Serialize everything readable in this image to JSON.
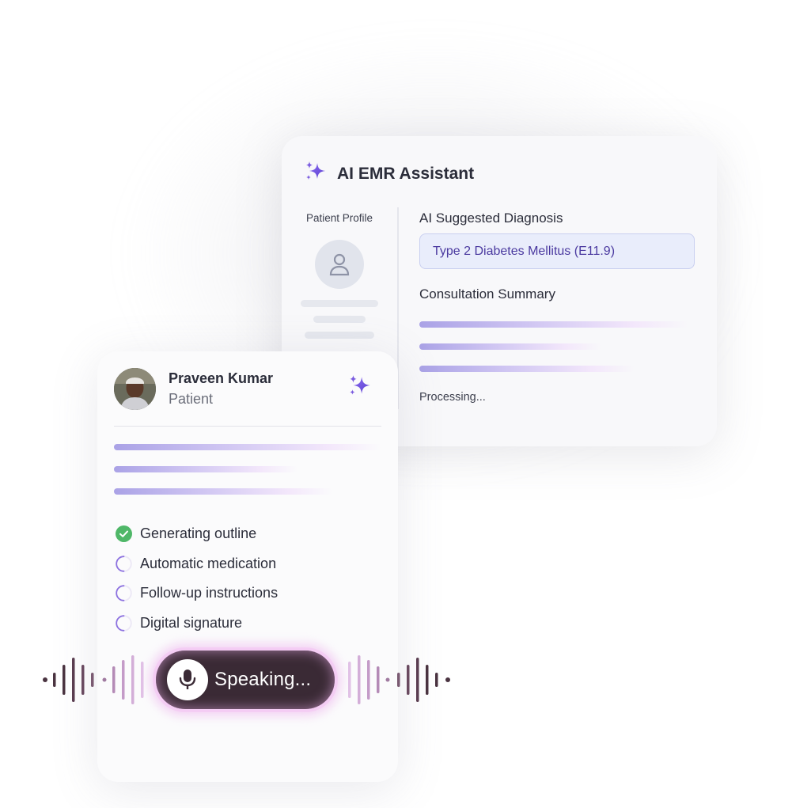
{
  "emr": {
    "title": "AI EMR Assistant",
    "profile_label": "Patient Profile",
    "diagnosis_label": "AI Suggested Diagnosis",
    "diagnosis_value": "Type 2 Diabetes Mellitus (E11.9)",
    "summary_label": "Consultation Summary",
    "status": "Processing..."
  },
  "patient": {
    "name": "Praveen Kumar",
    "role": "Patient"
  },
  "tasks": [
    {
      "label": "Generating outline",
      "state": "done"
    },
    {
      "label": "Automatic medication",
      "state": "pending"
    },
    {
      "label": "Follow-up instructions",
      "state": "pending"
    },
    {
      "label": "Digital signature",
      "state": "pending"
    }
  ],
  "voice": {
    "status": "Speaking..."
  },
  "colors": {
    "accent": "#7b5ce0",
    "diagnosis_text": "#4b3aa0",
    "done_green": "#4fb768",
    "pill_bg": "#3a2a35"
  }
}
